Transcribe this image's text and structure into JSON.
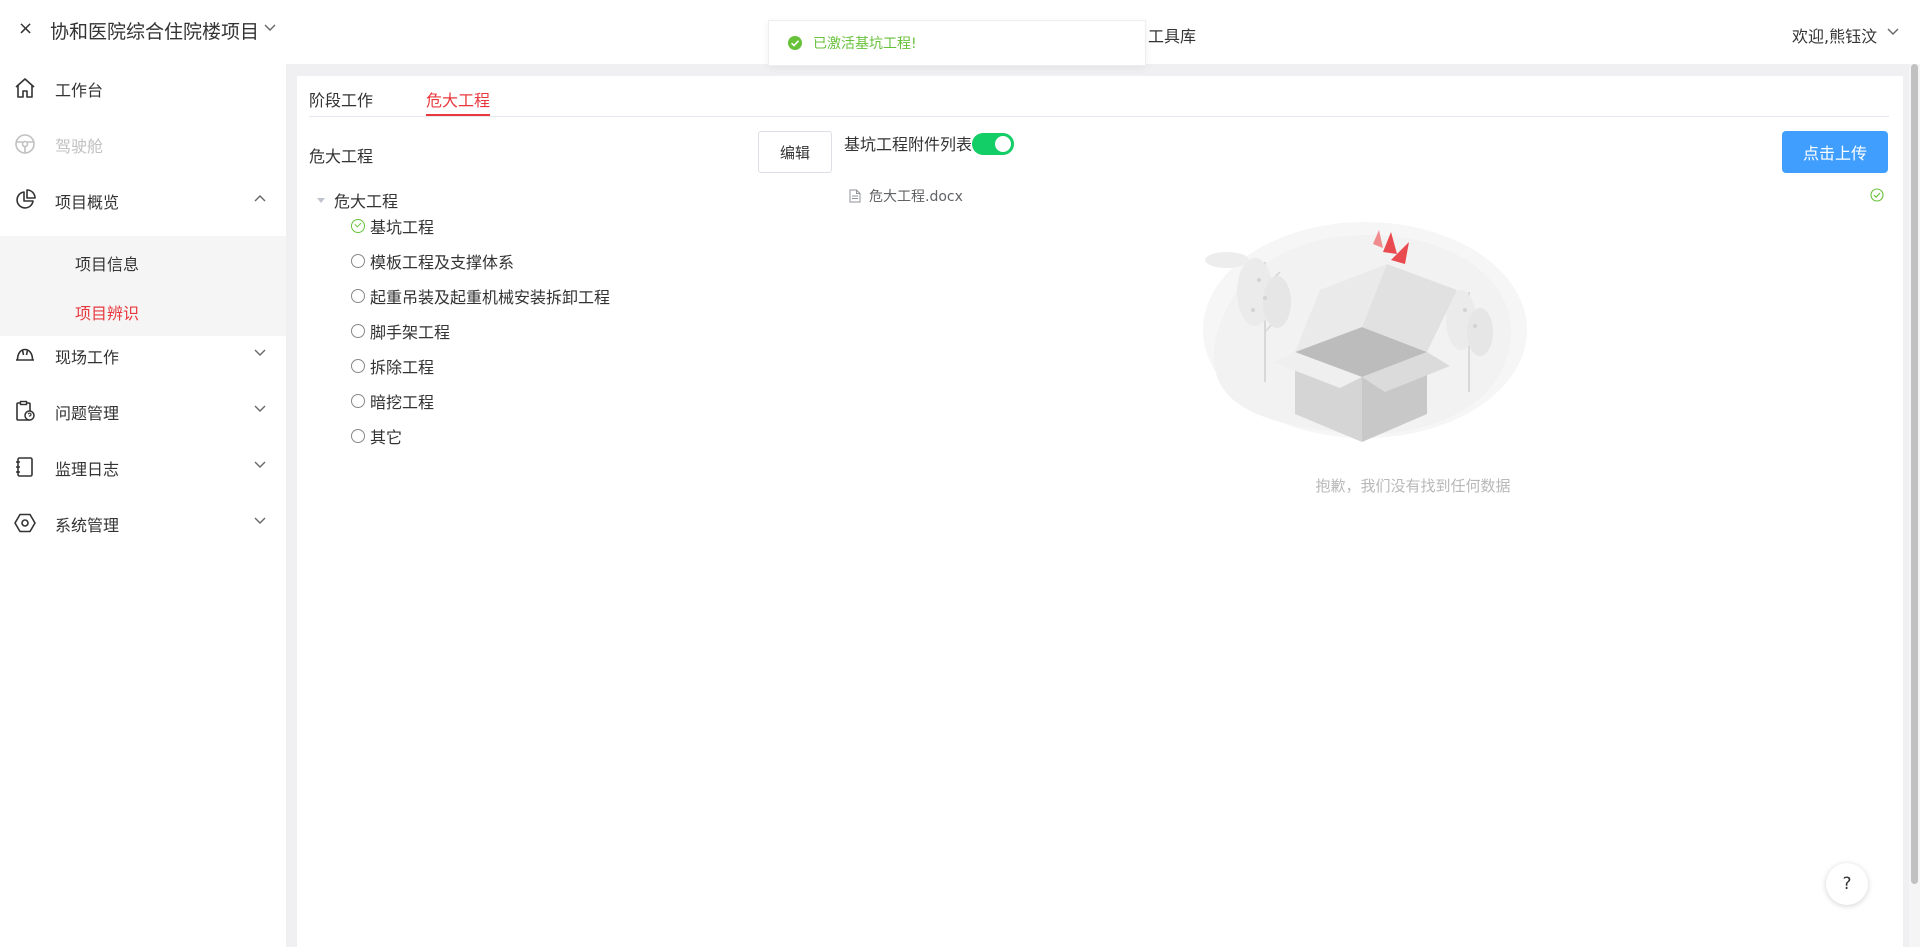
{
  "header": {
    "close_glyph": "×",
    "project_title": "协和医院综合住院楼项目",
    "toolbox_label": "工具库",
    "welcome_text": "欢迎,熊钰汶"
  },
  "toast": {
    "message": "已激活基坑工程!",
    "color": "#67c23a"
  },
  "sidebar": {
    "items": [
      {
        "label": "工作台",
        "icon": "home-icon"
      },
      {
        "label": "驾驶舱",
        "icon": "steering-wheel-icon"
      },
      {
        "label": "项目概览",
        "icon": "pie-chart-icon"
      },
      {
        "label": "现场工作",
        "icon": "hard-hat-icon"
      },
      {
        "label": "问题管理",
        "icon": "clipboard-question-icon"
      },
      {
        "label": "监理日志",
        "icon": "notebook-icon"
      },
      {
        "label": "系统管理",
        "icon": "settings-hex-icon"
      }
    ],
    "sub_items": [
      {
        "label": "项目信息"
      },
      {
        "label": "项目辨识"
      }
    ]
  },
  "tabs": [
    {
      "label": "阶段工作"
    },
    {
      "label": "危大工程"
    }
  ],
  "left_panel": {
    "title": "危大工程",
    "edit_label": "编辑",
    "tree_root": "危大工程",
    "tree_children": [
      {
        "label": "基坑工程",
        "checked": true
      },
      {
        "label": "模板工程及支撑体系",
        "checked": false
      },
      {
        "label": "起重吊装及起重机械安装拆卸工程",
        "checked": false
      },
      {
        "label": "脚手架工程",
        "checked": false
      },
      {
        "label": "拆除工程",
        "checked": false
      },
      {
        "label": "暗挖工程",
        "checked": false
      },
      {
        "label": "其它",
        "checked": false
      }
    ]
  },
  "right_panel": {
    "attach_label": "基坑工程附件列表",
    "switch_on": true,
    "upload_label": "点击上传",
    "file_name": "危大工程.docx",
    "empty_text": "抱歉，我们没有找到任何数据"
  },
  "help": {
    "glyph": "?"
  },
  "colors": {
    "accent_red": "#e8383d",
    "primary_blue": "#409eff",
    "success_green": "#67c23a",
    "switch_green": "#13ce66"
  }
}
